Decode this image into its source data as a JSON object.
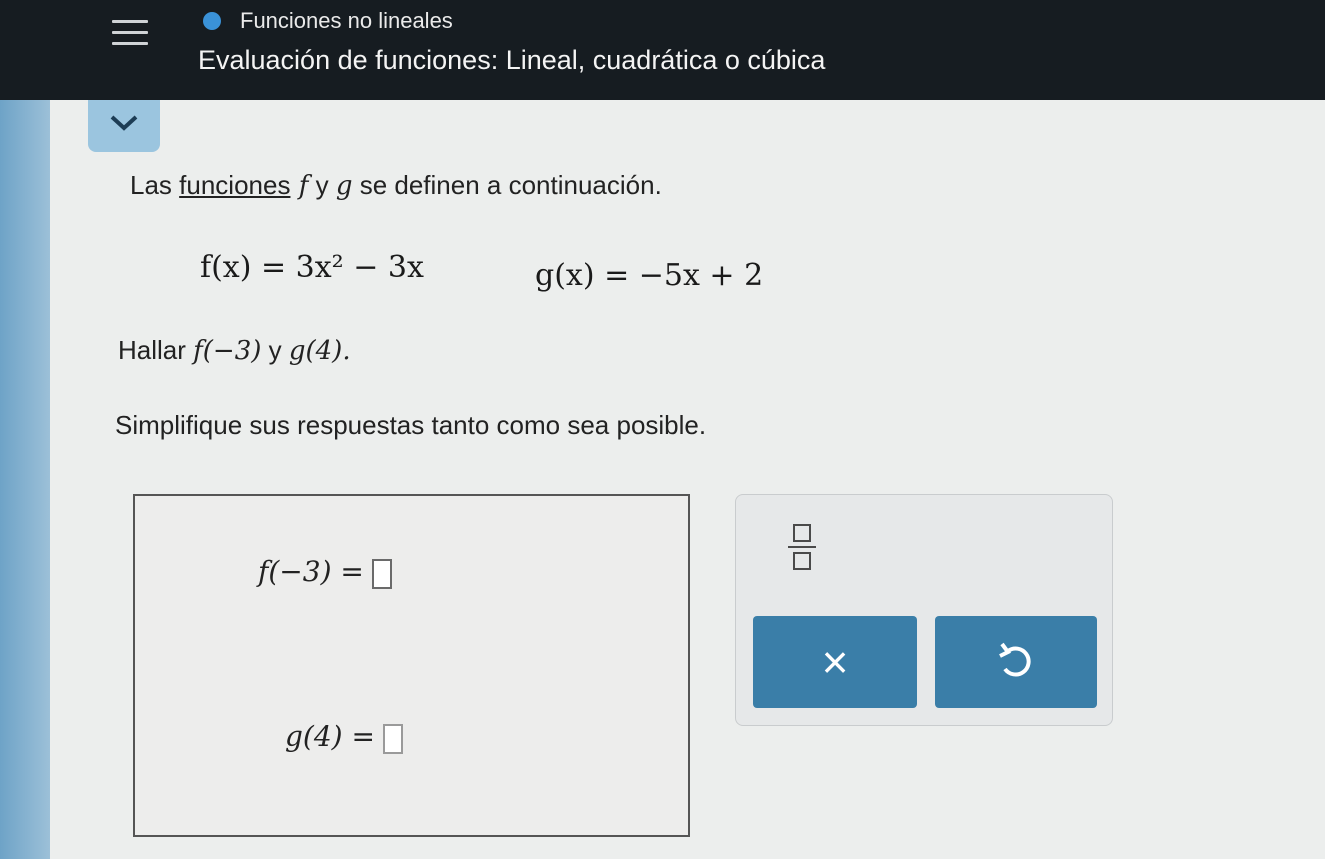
{
  "header": {
    "topic": "Funciones no lineales",
    "title": "Evaluación de funciones: Lineal, cuadrática o cúbica"
  },
  "colors": {
    "header_bg": "#161c21",
    "accent": "#3a7ea8",
    "topic_dot": "#3a92d8",
    "tab": "#9bc5df"
  },
  "question": {
    "intro_a": "Las ",
    "intro_link": "funciones",
    "intro_f": " f",
    "intro_y": " y ",
    "intro_g": "g",
    "intro_b": " se definen a continuación.",
    "f_def": "f(x) = 3x² − 3x",
    "g_def": "g(x) = −5x + 2",
    "find_a": "Hallar ",
    "find_f": "f(−3)",
    "find_y": " y ",
    "find_g": "g(4).",
    "simplify": "Simplifique sus respuestas tanto como sea posible."
  },
  "answers": {
    "f_label": "f(−3) =",
    "g_label": "g(4) ="
  },
  "tools": {
    "fraction_icon": "fraction-icon",
    "clear_label": "×",
    "undo_icon": "undo-icon"
  }
}
